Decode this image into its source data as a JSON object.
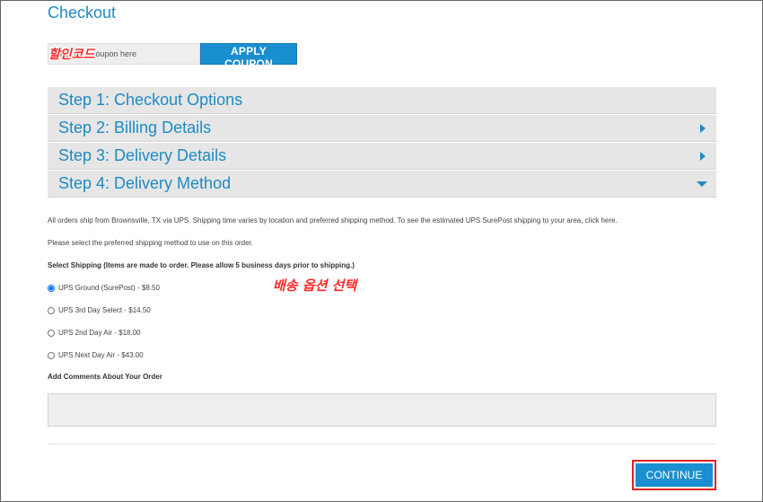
{
  "page": {
    "title": "Checkout"
  },
  "coupon": {
    "placeholder": "Enter your coupon here",
    "apply_label": "APPLY COUPON",
    "annotation": "할인코드"
  },
  "steps": [
    {
      "title": "Step 1: Checkout Options",
      "indicator": "none"
    },
    {
      "title": "Step 2: Billing Details",
      "indicator": "triangle-right-icon"
    },
    {
      "title": "Step 3: Delivery Details",
      "indicator": "triangle-right-icon"
    },
    {
      "title": "Step 4: Delivery Method",
      "indicator": "triangle-down-icon"
    }
  ],
  "delivery": {
    "info_text": "All orders ship from Brownsville, TX via UPS. Shipping time varies by location and preferred shipping method. To see the estimated UPS SurePost shipping to your area, click here.",
    "prompt_text": "Please select the preferred shipping method to use on this order.",
    "select_label": "Select Shipping (Items are made to order. Please allow 5 business days prior to shipping.)",
    "options": [
      {
        "label": "UPS Ground (SurePost) - $8.50",
        "selected": true
      },
      {
        "label": "UPS 3rd Day Select - $14.50",
        "selected": false
      },
      {
        "label": "UPS 2nd Day Air - $18.00",
        "selected": false
      },
      {
        "label": "UPS Next Day Air - $43.00",
        "selected": false
      }
    ],
    "annotation": "배송 옵션 선택",
    "comments_label": "Add Comments About Your Order",
    "comments_value": ""
  },
  "actions": {
    "continue_label": "CONTINUE"
  },
  "colors": {
    "accent": "#1a8fd0",
    "step_text": "#1e8bc3",
    "step_bg": "#e6e6e6",
    "annotation": "#ff2a2a"
  }
}
